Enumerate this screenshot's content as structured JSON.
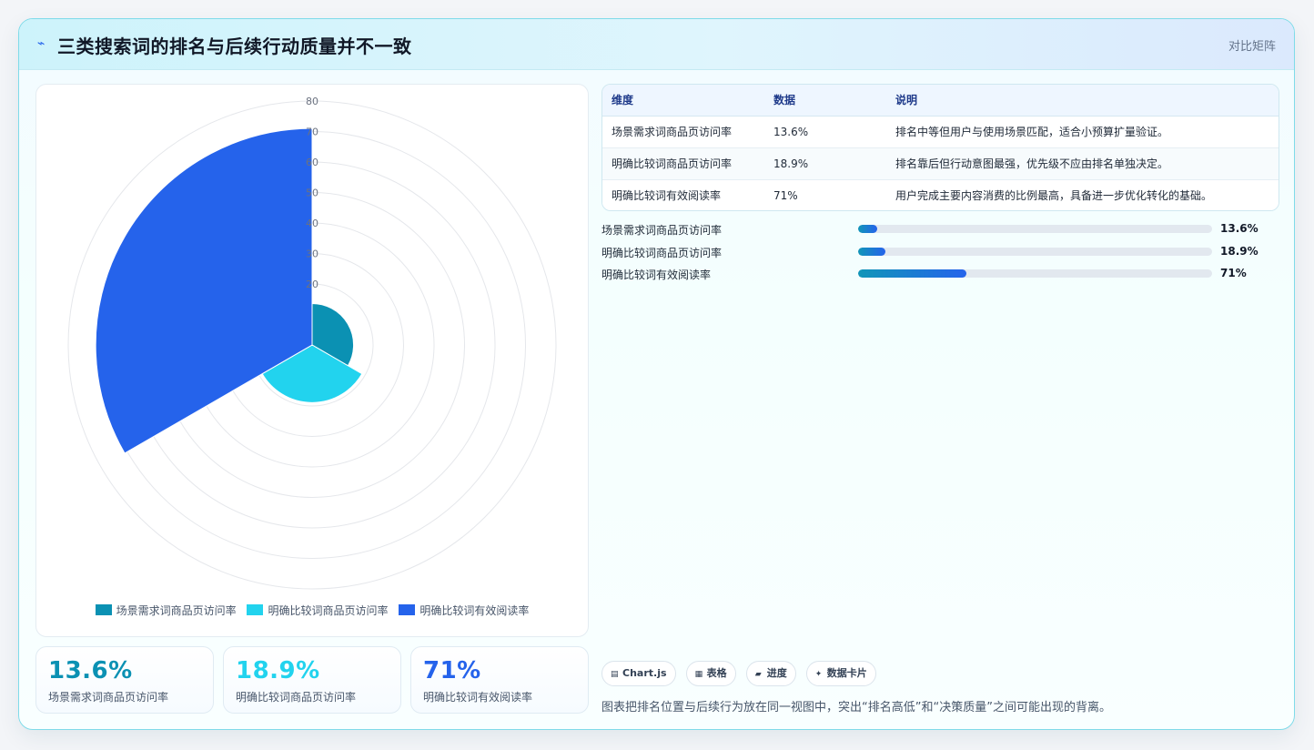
{
  "header": {
    "title": "三类搜索词的排名与后续行动质量并不一致",
    "tag": "对比矩阵"
  },
  "chart_data": {
    "type": "polarArea",
    "categories": [
      "场景需求词商品页访问率",
      "明确比较词商品页访问率",
      "明确比较词有效阅读率"
    ],
    "values": [
      13.6,
      18.9,
      71
    ],
    "colors": [
      "#0b91b3",
      "#22d3ee",
      "#2563eb"
    ],
    "r_max": 80,
    "r_tick_step": 10,
    "r_tick_labels": [
      "80",
      "70",
      "60",
      "50",
      "40",
      "30",
      "20"
    ],
    "legend_position": "bottom"
  },
  "stats": [
    {
      "value": "13.6%",
      "label": "场景需求词商品页访问率",
      "color": "#0b91b3"
    },
    {
      "value": "18.9%",
      "label": "明确比较词商品页访问率",
      "color": "#22d3ee"
    },
    {
      "value": "71%",
      "label": "明确比较词有效阅读率",
      "color": "#2563eb"
    }
  ],
  "table": {
    "headers": [
      "维度",
      "数据",
      "说明"
    ],
    "rows": [
      [
        "场景需求词商品页访问率",
        "13.6%",
        "排名中等但用户与使用场景匹配，适合小预算扩量验证。"
      ],
      [
        "明确比较词商品页访问率",
        "18.9%",
        "排名靠后但行动意图最强，优先级不应由排名单独决定。"
      ],
      [
        "明确比较词有效阅读率",
        "71%",
        "用户完成主要内容消费的比例最高，具备进一步优化转化的基础。"
      ]
    ]
  },
  "progress": [
    {
      "label": "场景需求词商品页访问率",
      "value": "13.6%",
      "fraction": 0.055
    },
    {
      "label": "明确比较词商品页访问率",
      "value": "18.9%",
      "fraction": 0.076
    },
    {
      "label": "明确比较词有效阅读率",
      "value": "71%",
      "fraction": 0.307
    }
  ],
  "chips": [
    {
      "icon": "chart-icon",
      "glyph": "▤",
      "label": "Chart.js"
    },
    {
      "icon": "table-icon",
      "glyph": "▦",
      "label": "表格"
    },
    {
      "icon": "progress-icon",
      "glyph": "▰",
      "label": "进度"
    },
    {
      "icon": "card-icon",
      "glyph": "✦",
      "label": "数据卡片"
    }
  ],
  "caption": "图表把排名位置与后续行为放在同一视图中，突出“排名高低”和“决策质量”之间可能出现的背离。"
}
